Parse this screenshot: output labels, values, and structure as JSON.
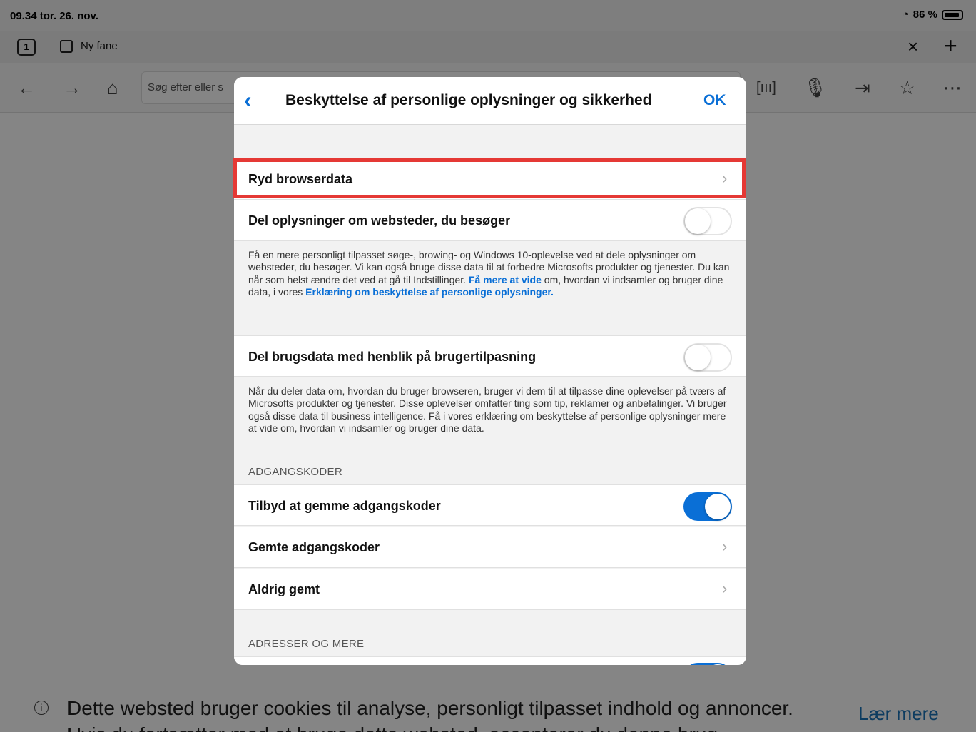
{
  "status_bar": {
    "time_date": "09.34  tor. 26. nov.",
    "battery": "86 %"
  },
  "tab_bar": {
    "tab_count": "1",
    "tab_title": "Ny fane",
    "close_icon": "×",
    "add_icon": "+"
  },
  "toolbar": {
    "address_placeholder": "Søg efter eller s"
  },
  "modal": {
    "title": "Beskyttelse af personlige oplysninger og sikkerhed",
    "ok": "OK",
    "rows": {
      "clear_data": "Ryd browserdata",
      "share_sites": "Del oplysninger om websteder, du besøger",
      "share_usage": "Del brugsdata med henblik på brugertilpasning",
      "offer_save_passwords": "Tilbyd at gemme adgangskoder",
      "saved_passwords": "Gemte adgangskoder",
      "never_saved": "Aldrig gemt"
    },
    "desc_sites": {
      "text": "Få en mere personligt tilpasset søge-, browing- og Windows 10-oplevelse ved at dele oplysninger om websteder, du besøger. Vi kan også bruge disse data til at forbedre Microsofts produkter og tjenester. Du kan når som helst ændre det ved at gå til Indstillinger. ",
      "link1": "Få mere at vide",
      "mid": " om, hvordan vi indsamler og bruger dine data, i vores ",
      "link2": "Erklæring om beskyttelse af personlige oplysninger."
    },
    "desc_usage": "Når du deler data om, hvordan du bruger browseren, bruger vi dem til at tilpasse dine oplevelser på tværs af Microsofts produkter og tjenester. Disse oplevelser omfatter ting som tip, reklamer og anbefalinger. Vi bruger også disse data til business intelligence. Få i vores erklæring om beskyttelse af personlige oplysninger mere at vide om, hvordan vi indsamler og bruger dine data.",
    "section_passwords": "ADGANGSKODER",
    "section_addresses": "ADRESSER OG MERE",
    "toggles": {
      "share_sites": false,
      "share_usage": false,
      "offer_save_passwords": true
    }
  },
  "cookie_banner": {
    "text": "Dette websted bruger cookies til analyse, personligt tilpasset indhold og annoncer. Hvis du fortsætter med at bruge dette websted, accepterer du denne brug.",
    "learn_more": "Lær mere"
  },
  "colors": {
    "accent": "#0a6fd6",
    "highlight": "#e53935"
  }
}
